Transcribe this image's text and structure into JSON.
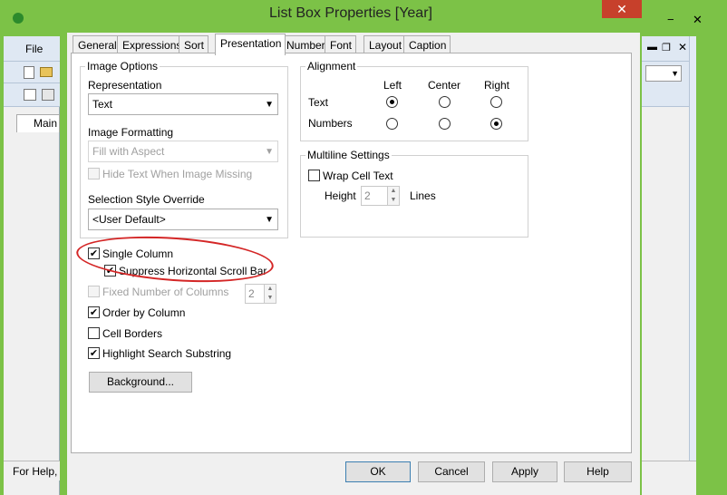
{
  "dialog": {
    "title": "List Box Properties [Year]",
    "close_glyph": "✕",
    "tabs": [
      "General",
      "Expressions",
      "Sort",
      "Presentation",
      "Number",
      "Font",
      "Layout",
      "Caption"
    ],
    "active_tab": "Presentation"
  },
  "image_options": {
    "group_label": "Image Options",
    "representation_label": "Representation",
    "representation_value": "Text",
    "image_formatting_label": "Image Formatting",
    "image_formatting_value": "Fill with Aspect",
    "hide_text_label": "Hide Text When Image Missing",
    "selection_style_label": "Selection Style Override",
    "selection_style_value": "<User Default>"
  },
  "checkboxes": {
    "single_column": "Single Column",
    "suppress_hscroll": "Suppress Horizontal Scroll Bar",
    "fixed_columns": "Fixed Number of Columns",
    "fixed_columns_value": "2",
    "order_by_column": "Order by Column",
    "cell_borders": "Cell Borders",
    "highlight_search": "Highlight Search Substring"
  },
  "states": {
    "single_column": true,
    "suppress_hscroll": true,
    "fixed_columns": false,
    "order_by_column": true,
    "cell_borders": false,
    "highlight_search": true,
    "hide_text": false,
    "wrap_cell_text": false
  },
  "background_button": "Background...",
  "alignment": {
    "group_label": "Alignment",
    "columns": [
      "Left",
      "Center",
      "Right"
    ],
    "rows": [
      {
        "label": "Text",
        "selected": "Left"
      },
      {
        "label": "Numbers",
        "selected": "Right"
      }
    ]
  },
  "multiline": {
    "group_label": "Multiline Settings",
    "wrap_label": "Wrap Cell Text",
    "height_label": "Height",
    "height_value": "2",
    "lines_label": "Lines"
  },
  "buttons": {
    "ok": "OK",
    "cancel": "Cancel",
    "apply": "Apply",
    "help": "Help"
  },
  "background_app": {
    "menu_file": "File",
    "sheet_tab": "Main",
    "status_text": "For Help,"
  }
}
